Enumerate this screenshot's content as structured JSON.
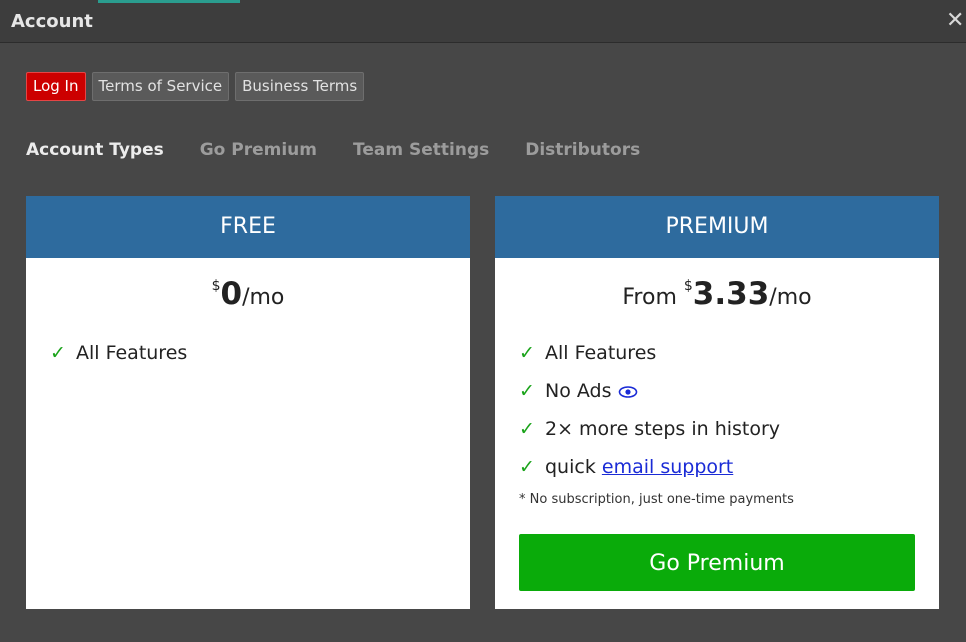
{
  "window": {
    "title": "Account",
    "close_glyph": "✕"
  },
  "buttons": [
    {
      "label": "Log In",
      "style": "red"
    },
    {
      "label": "Terms of Service",
      "style": "gray"
    },
    {
      "label": "Business Terms",
      "style": "gray"
    }
  ],
  "tabs": [
    {
      "label": "Account Types",
      "active": true
    },
    {
      "label": "Go Premium",
      "active": false
    },
    {
      "label": "Team Settings",
      "active": false
    },
    {
      "label": "Distributors",
      "active": false
    }
  ],
  "free_card": {
    "title": "FREE",
    "price_prefix": "",
    "currency": "$",
    "amount": "0",
    "period": "/mo",
    "features": [
      "All Features"
    ]
  },
  "premium_card": {
    "title": "PREMIUM",
    "price_prefix": "From ",
    "currency": "$",
    "amount": "3.33",
    "period": "/mo",
    "features": {
      "f1": "All Features",
      "f2": "No Ads",
      "f2_icon": "eye-icon",
      "f3": "2× more steps in history",
      "f4_prefix": "quick ",
      "f4_link": "email support"
    },
    "note": "* No subscription, just one-time payments",
    "cta": "Go Premium"
  },
  "colors": {
    "header_blue": "#2e6b9e",
    "cta_green": "#0aab0a",
    "login_red": "#cc0000",
    "check_green": "#1aa31a",
    "link_blue": "#1a2bd6"
  }
}
